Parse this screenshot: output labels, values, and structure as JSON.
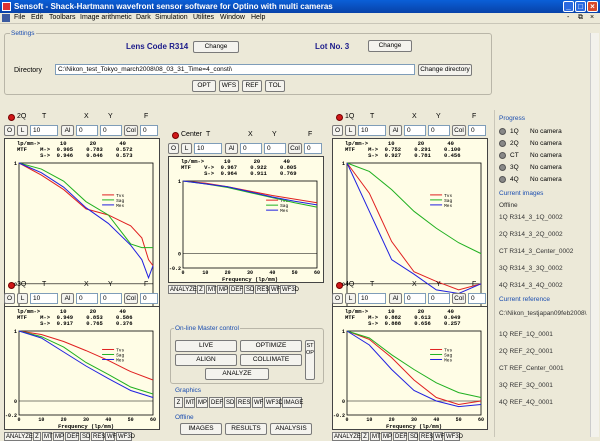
{
  "window": {
    "title": "Sensoft - Shack-Hartmann wavefront sensor software for Optino with multi cameras",
    "min": "_",
    "max": "□",
    "close": "×"
  },
  "menu": [
    "File",
    "Edit",
    "Toolbars",
    "Image arithmetic",
    "Dark",
    "Simulation",
    "Utilites",
    "Window",
    "Help"
  ],
  "menu_right": {
    "min": "-",
    "restore": "⧉",
    "close": "×"
  },
  "settings": {
    "group": "Settings",
    "lens_code": "Lens Code R314",
    "lot": "Lot No. 3",
    "change": "Change",
    "directory_label": "Directory",
    "directory_value": "C:\\Nikon_test_Tokyo_march2008\\08_03_31_Time=4_consti\\",
    "change_directory": "Change directory",
    "opt": "OPT",
    "wfs": "WFS",
    "ref": "REF",
    "tol": "TOL"
  },
  "panel_headers": {
    "t": "T",
    "x": "X",
    "y": "Y",
    "f": "F",
    "o": "O",
    "l": "L",
    "al": "Al",
    "col": "Col"
  },
  "panel_field_values": {
    "ten": "10",
    "zero": "0"
  },
  "panels": [
    {
      "name": "2Q",
      "table": "lp/mm->      10       20       40\nMTF    M->  0.905    0.783    0.572\n       S->  0.946    0.846    0.573"
    },
    {
      "name": "Center",
      "table": "lp/mm->      10       20       40\nMTF    V->  0.967    0.922    0.805\n       S->  0.964    0.911    0.769"
    },
    {
      "name": "1Q",
      "table": "lp/mm->      10       20       40\nMTF    M->  0.752    0.291    0.100\n       S->  0.927    0.781    0.456"
    },
    {
      "name": "3Q",
      "table": "lp/mm->      10       20       40\nMTF    M->  0.949    0.853    0.586\n       S->  0.917    0.765    0.376"
    },
    {
      "name": "4Q",
      "table": "lp/mm->      10       20       40\nMTF    M->  0.882    0.613    0.049\n       S->  0.888    0.656    0.257"
    }
  ],
  "plot_labels": {
    "xlabel": "Frequency (lp/mm)",
    "legend": [
      "Tvs",
      "Sag",
      "Mes"
    ],
    "ytick_top": "1",
    "ytick_zero": "0",
    "ytick_neg": "-0.2",
    "xticks": [
      "0",
      "10",
      "20",
      "30",
      "40",
      "50",
      "60"
    ]
  },
  "toolbar_buttons": [
    "ANALYZE",
    "Z",
    "MT",
    "MP",
    "DEF",
    "SD",
    "RES",
    "WF",
    "WF3D"
  ],
  "control": {
    "group": "On-line Master control",
    "live": "LIVE",
    "optimize": "OPTIMIZE",
    "align": "ALIGN",
    "collimate": "COLLIMATE",
    "analyze": "ANALYZE",
    "stop": "STOP",
    "graphics": "Graphics",
    "graphics_buttons": [
      "Z",
      "MT",
      "MP",
      "DEF",
      "SD",
      "RES",
      "WF",
      "WF3D",
      "IMAGE"
    ],
    "offline": "Offline",
    "images": "IMAGES",
    "results": "RESULTS",
    "analysis": "ANALYSIS"
  },
  "progress": {
    "title": "Progress",
    "items": [
      {
        "label": "1Q",
        "status": "No camera"
      },
      {
        "label": "2Q",
        "status": "No camera"
      },
      {
        "label": "CT",
        "status": "No camera"
      },
      {
        "label": "3Q",
        "status": "No camera"
      },
      {
        "label": "4Q",
        "status": "No camera"
      }
    ]
  },
  "current_images": {
    "title": "Current images",
    "sub": "Offline",
    "items": [
      "1Q R314_3_1Q_0002",
      "2Q R314_3_2Q_0002",
      "CT R314_3_Center_0002",
      "3Q R314_3_3Q_0002",
      "4Q R314_3_4Q_0002"
    ]
  },
  "current_reference": {
    "title": "Current reference",
    "path": "C:\\Nikon_testjapan09feb2008\\",
    "items": [
      "1Q REF_1Q_0001",
      "2Q REF_2Q_0001",
      "CT REF_Center_0001",
      "3Q REF_3Q_0001",
      "4Q REF_4Q_0001"
    ]
  },
  "colors": {
    "title_bar": "#0842a8",
    "tvs": "#e02020",
    "sag": "#20b020",
    "mes": "#2020e0",
    "group_text": "#1a4db0"
  }
}
